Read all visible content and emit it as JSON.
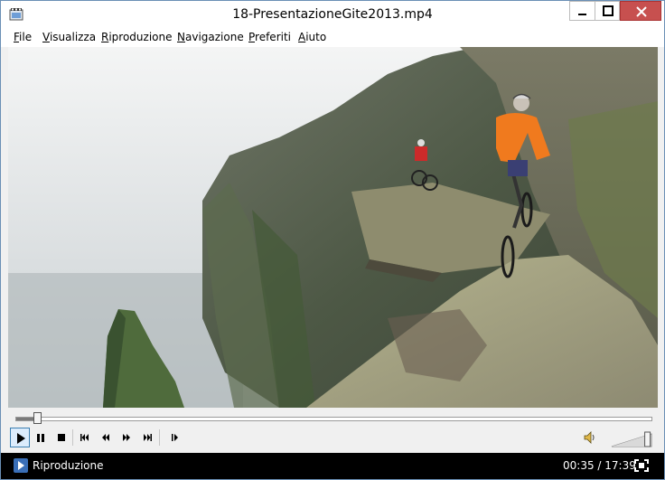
{
  "window": {
    "title": "18-PresentazioneGite2013.mp4",
    "accent_close": "#c7504f"
  },
  "menu": {
    "items": [
      {
        "label": "File"
      },
      {
        "label": "Visualizza"
      },
      {
        "label": "Riproduzione"
      },
      {
        "label": "Navigazione"
      },
      {
        "label": "Preferiti"
      },
      {
        "label": "Aiuto"
      }
    ]
  },
  "video": {
    "scene": "cyclists-on-cliff-edge"
  },
  "seek": {
    "progress_fraction": 0.033
  },
  "controls": {
    "icons": [
      "play-icon",
      "pause-icon",
      "stop-icon",
      "previous-icon",
      "rewind-icon",
      "fast-forward-icon",
      "next-icon",
      "frame-step-icon",
      "volume-icon"
    ],
    "volume_fraction": 0.9
  },
  "status": {
    "state": "Riproduzione",
    "time": "00:35 / 17:39"
  }
}
